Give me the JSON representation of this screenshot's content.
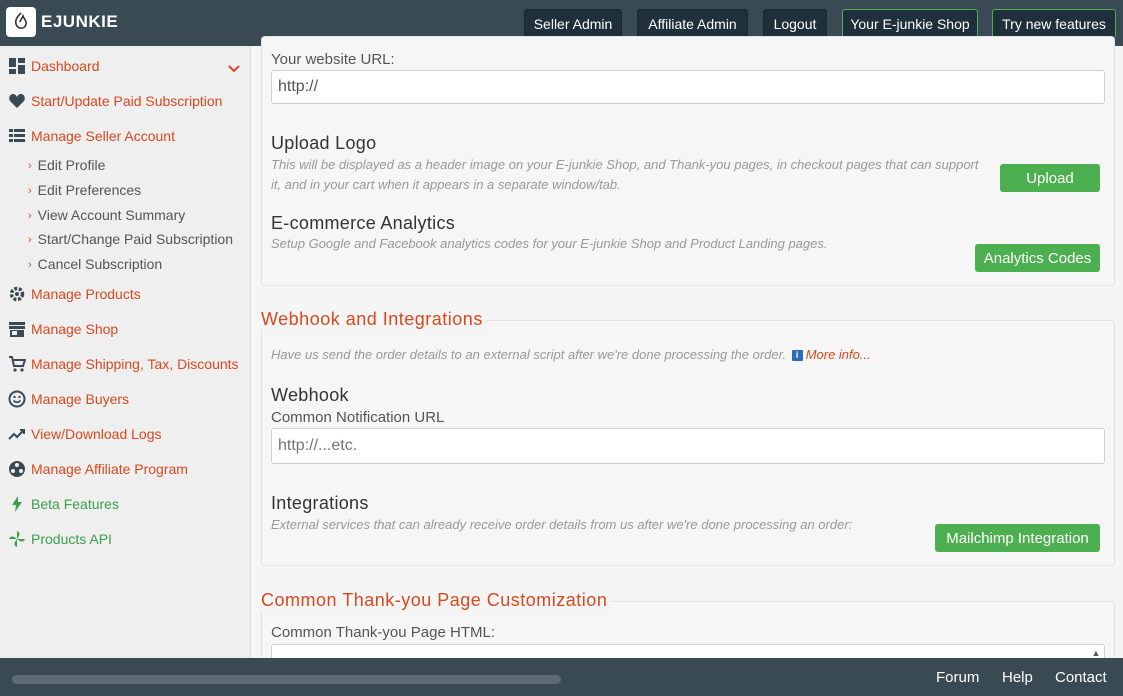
{
  "header": {
    "brand": "EJUNKIE",
    "buttons": {
      "seller_admin": "Seller Admin",
      "affiliate_admin": "Affiliate Admin",
      "logout": "Logout",
      "shop": "Your E-junkie Shop",
      "try_new": "Try new features"
    }
  },
  "sidebar": {
    "dashboard": "Dashboard",
    "subscription": "Start/Update Paid Subscription",
    "manage_seller": "Manage Seller Account",
    "sub_items": [
      "Edit Profile",
      "Edit Preferences",
      "View Account Summary",
      "Start/Change Paid Subscription",
      "Cancel Subscription"
    ],
    "manage_products": "Manage Products",
    "manage_shop": "Manage Shop",
    "manage_shipping": "Manage Shipping, Tax, Discounts",
    "manage_buyers": "Manage Buyers",
    "logs": "View/Download Logs",
    "affiliate": "Manage Affiliate Program",
    "beta": "Beta Features",
    "api": "Products API"
  },
  "main": {
    "website_url_label": "Your website URL:",
    "website_url_value": "http://",
    "upload_logo_heading": "Upload Logo",
    "upload_logo_desc": "This will be displayed as a header image on your E-junkie Shop, and Thank-you pages, in checkout pages that can support it, and in your cart when it appears in a separate window/tab.",
    "upload_button": "Upload",
    "analytics_heading": "E-commerce Analytics",
    "analytics_desc": "Setup Google and Facebook analytics codes for your E-junkie Shop and Product Landing pages.",
    "analytics_button": "Analytics Codes",
    "webhook_section": "Webhook and Integrations",
    "webhook_intro": "Have us send the order details to an external script after we're done processing the order.",
    "more_info": "More info...",
    "webhook_heading": "Webhook",
    "notification_label": "Common Notification URL",
    "notification_placeholder": "http://...etc.",
    "integrations_heading": "Integrations",
    "integrations_desc": "External services that can already receive order details from us after we're done processing an order:",
    "mailchimp_button": "Mailchimp Integration",
    "thankyou_section": "Common Thank-you Page Customization",
    "thankyou_label": "Common Thank-you Page HTML:"
  },
  "footer": {
    "forum": "Forum",
    "help": "Help",
    "contact": "Contact"
  },
  "colors": {
    "accent": "#d9481f",
    "green": "#4caf50",
    "topbar": "#3a4a55"
  }
}
